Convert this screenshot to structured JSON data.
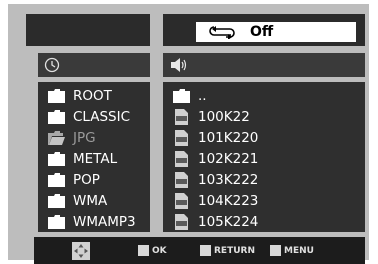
{
  "repeat": {
    "icon": "repeat-icon",
    "value": "Off"
  },
  "left_header": {
    "icon": "clock-icon"
  },
  "right_header": {
    "icon": "speaker-icon"
  },
  "folders": [
    {
      "label": "ROOT",
      "icon": "folder-icon",
      "state": "normal"
    },
    {
      "label": "CLASSIC",
      "icon": "folder-icon",
      "state": "normal"
    },
    {
      "label": "JPG",
      "icon": "folder-open-icon",
      "state": "dimmed"
    },
    {
      "label": "METAL",
      "icon": "folder-icon",
      "state": "normal"
    },
    {
      "label": "POP",
      "icon": "folder-icon",
      "state": "normal"
    },
    {
      "label": "WMA",
      "icon": "folder-icon",
      "state": "normal"
    },
    {
      "label": "WMAMP3",
      "icon": "folder-icon",
      "state": "normal"
    }
  ],
  "files": [
    {
      "label": "..",
      "icon": "folder-icon"
    },
    {
      "label": "100K22",
      "icon": "jpg-file-icon"
    },
    {
      "label": "101K220",
      "icon": "jpg-file-icon"
    },
    {
      "label": "102K221",
      "icon": "jpg-file-icon"
    },
    {
      "label": "103K222",
      "icon": "jpg-file-icon"
    },
    {
      "label": "104K223",
      "icon": "jpg-file-icon"
    },
    {
      "label": "105K224",
      "icon": "jpg-file-icon"
    }
  ],
  "footer": {
    "nav_icon": "direction-pad-icon",
    "ok_label": "OK",
    "return_label": "RETURN",
    "menu_label": "MENU"
  }
}
